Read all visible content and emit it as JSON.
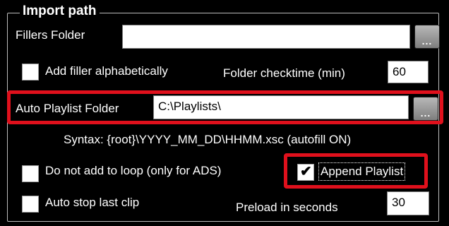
{
  "group": {
    "title": "Import path"
  },
  "fillers_folder": {
    "label": "Fillers Folder",
    "value": "",
    "browse_icon": "ellipsis-icon",
    "browse_label": "..."
  },
  "add_filler_alpha": {
    "label": "Add filler alphabetically",
    "checked": false
  },
  "folder_checktime": {
    "label": "Folder checktime (min)",
    "value": "60"
  },
  "auto_playlist_folder": {
    "label": "Auto Playlist Folder",
    "value": "C:\\Playlists\\",
    "browse_label": "..."
  },
  "syntax_hint": "Syntax: {root}\\YYYY_MM_DD\\HHMM.xsc (autofill ON)",
  "do_not_add_loop": {
    "label": "Do not add to loop (only for ADS)",
    "checked": false
  },
  "append_playlist": {
    "label": "Append Playlist",
    "checked": true,
    "check_glyph": "✔"
  },
  "auto_stop_last_clip": {
    "label": "Auto stop last clip",
    "checked": false
  },
  "preload_seconds": {
    "label": "Preload in seconds",
    "value": "30"
  },
  "colors": {
    "background": "#000000",
    "highlight": "#e0101c",
    "text": "#ffffff"
  }
}
